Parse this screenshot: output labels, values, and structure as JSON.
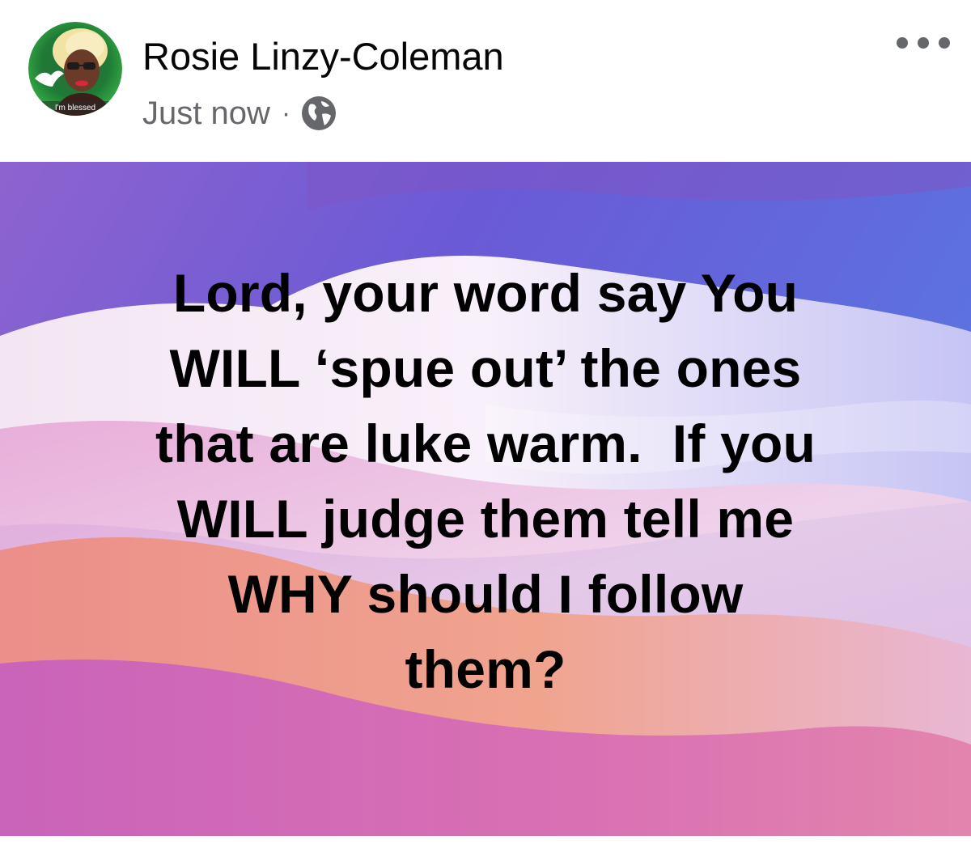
{
  "post": {
    "author": {
      "name": "Rosie Linzy-Coleman",
      "avatar_caption": "I'm blessed"
    },
    "meta": {
      "timestamp": "Just now",
      "separator": "·",
      "privacy_icon": "globe-icon"
    },
    "more_icon": "more-options-icon",
    "text_lines": [
      "Lord, your word say You",
      "WILL ‘spue out’ the ones",
      "that are luke warm.  If you",
      "WILL judge them tell me",
      "WHY should I follow",
      "them?"
    ],
    "background_colors": {
      "violet": "#6e5fd8",
      "lavender": "#c8b8f0",
      "white_wave": "#f7eef6",
      "coral": "#ee8a87",
      "magenta": "#cf66c0"
    },
    "colors": {
      "name_text": "#050505",
      "meta_text": "#65676b",
      "post_text": "#000000"
    }
  }
}
